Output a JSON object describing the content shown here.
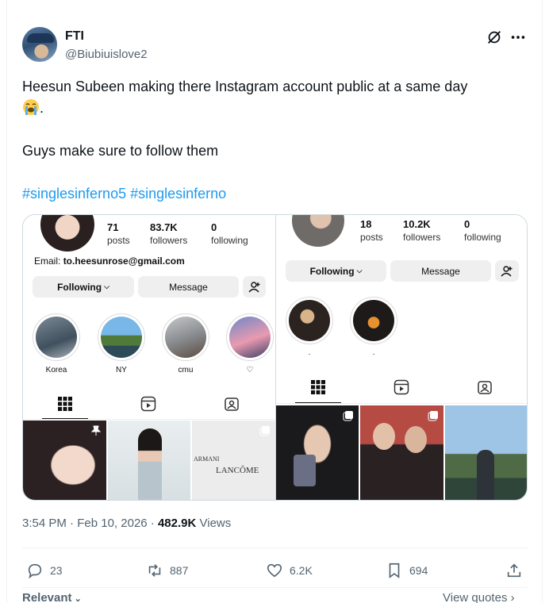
{
  "tweet": {
    "display_name": "FTI",
    "handle": "@Biubiuislove2",
    "text_line1": "Heesun Subeen making there Instagram account public at a same day",
    "text_line1_end": ".",
    "text_line2": "Guys make sure to follow them",
    "hashtag1": "#singlesinferno5",
    "hashtag2": "#singlesinferno",
    "emoji_name": "loudly-crying-face-icon"
  },
  "media": {
    "left_profile": {
      "posts": "71",
      "posts_label": "posts",
      "followers": "83.7K",
      "followers_label": "followers",
      "following": "0",
      "following_label": "following",
      "email_prefix": "Email:",
      "email": "to.heesunrose@gmail.com",
      "following_btn": "Following",
      "message_btn": "Message",
      "highlights": [
        "Korea",
        "NY",
        "cmu",
        "♡"
      ]
    },
    "right_profile": {
      "posts": "18",
      "posts_label": "posts",
      "followers": "10.2K",
      "followers_label": "followers",
      "following": "0",
      "following_label": "following",
      "following_btn": "Following",
      "message_btn": "Message",
      "highlights": [
        ".",
        "."
      ]
    },
    "thumb_texts": {
      "armani": "ARMANI",
      "lancome": "LANCÔME"
    }
  },
  "footer": {
    "time": "3:54 PM",
    "sep": "·",
    "date": "Feb 10, 2026",
    "sep2": "·",
    "views_count": "482.9K",
    "views_label": "Views",
    "replies": "23",
    "reposts": "887",
    "likes": "6.2K",
    "bookmarks": "694",
    "relevant": "Relevant",
    "view_quotes": "View quotes"
  },
  "colors": {
    "link": "#1d9bf0",
    "secondary": "#536471",
    "text": "#0f1419"
  }
}
